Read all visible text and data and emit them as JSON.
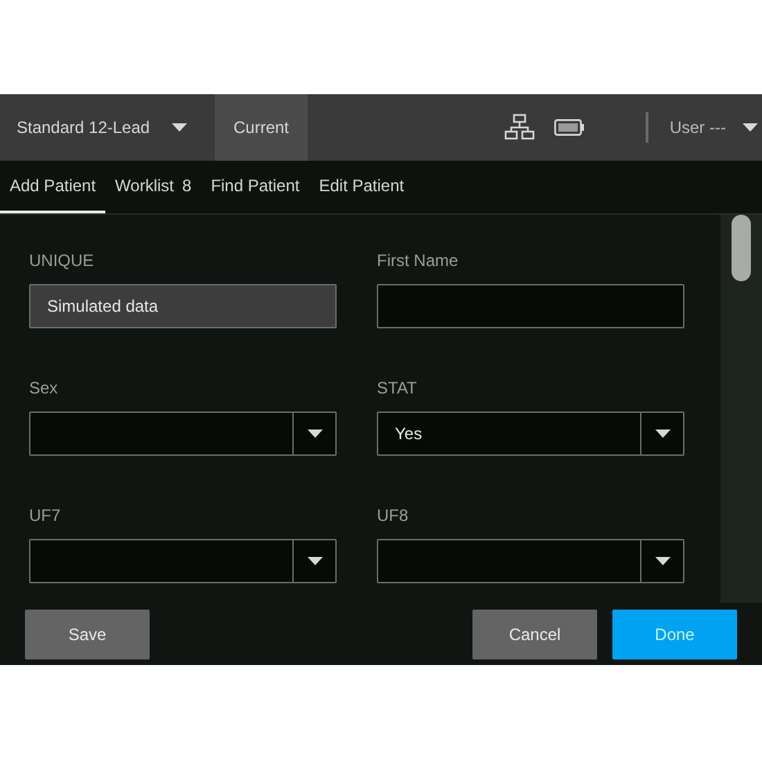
{
  "top_bar": {
    "protocol": "Standard 12-Lead",
    "mode": "Current",
    "user": "User ---"
  },
  "tabs": [
    {
      "label": "Add Patient",
      "selected": true
    },
    {
      "label": "Worklist",
      "count": "8",
      "selected": false
    },
    {
      "label": "Find Patient",
      "selected": false
    },
    {
      "label": "Edit Patient",
      "selected": false
    }
  ],
  "fields": [
    {
      "label": "UNIQUE",
      "kind": "text",
      "value": "Simulated data",
      "disabled": true
    },
    {
      "label": "First Name",
      "kind": "text",
      "disabled": false
    },
    {
      "label": "Sex",
      "kind": "dropdown"
    },
    {
      "label": "STAT",
      "kind": "dropdown",
      "value": "Yes"
    },
    {
      "label": "UF7",
      "kind": "dropdown"
    },
    {
      "label": "UF8",
      "kind": "dropdown"
    }
  ],
  "buttons": [
    {
      "label": "Save",
      "kind": "secondary"
    },
    {
      "label": "Cancel",
      "kind": "secondary"
    },
    {
      "label": "Done",
      "kind": "primary"
    }
  ]
}
